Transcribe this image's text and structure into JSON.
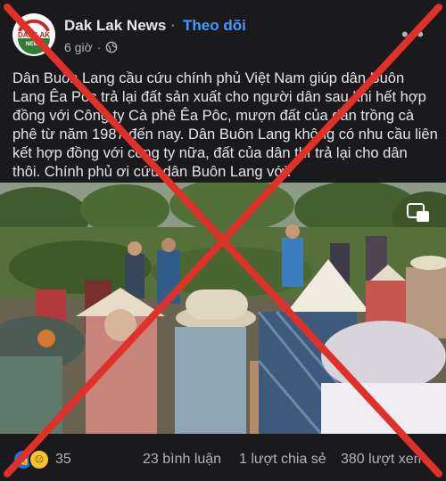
{
  "header": {
    "page_name": "Dak Lak News",
    "dot": "·",
    "follow_label": "Theo dõi",
    "time": "6 giờ",
    "meta_dot": "·",
    "avatar_text": "DAK LAK",
    "avatar_sub": "NEWS"
  },
  "post": {
    "text": "Dân Buôn Lang cầu cứu chính phủ Việt Nam giúp dân Buôn Lang Êa Pôc trả lại đất sản xuất cho người dân sau khi hết hợp đồng với Công ty Cà phê Êa Pôc, mượn đất của dân trồng cà phê từ năm 1987 đến nay. Dân Buôn Lang không có nhu cầu liên kết hợp đồng với công ty nữa, đất của dân thì trả lại cho dân thôi. Chính phủ ơi cứu dân Buôn Lang với."
  },
  "footer": {
    "reaction_count": "35",
    "comments": "23 bình luận",
    "shares": "1 lượt chia sẻ",
    "views": "380 lượt xem"
  },
  "colors": {
    "background": "#1a1a1c",
    "text": "#e4e6eb",
    "muted": "#b0b3b8",
    "follow": "#4599ff",
    "cross": "#e0302a"
  }
}
